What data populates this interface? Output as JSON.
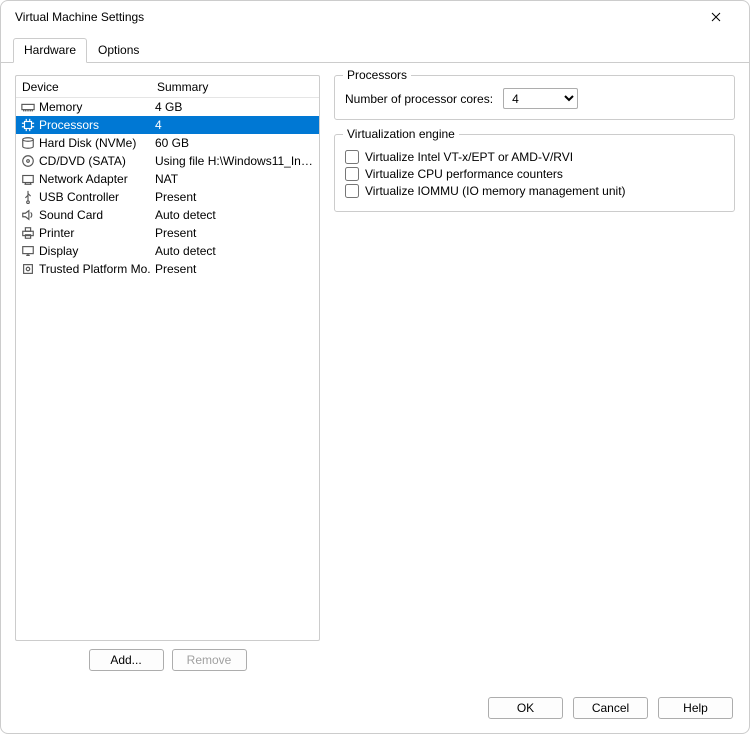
{
  "window": {
    "title": "Virtual Machine Settings"
  },
  "tabs": {
    "hardware": "Hardware",
    "options": "Options"
  },
  "deviceList": {
    "headerDevice": "Device",
    "headerSummary": "Summary",
    "rows": [
      {
        "icon": "memory-icon",
        "name": "Memory",
        "summary": "4 GB"
      },
      {
        "icon": "processors-icon",
        "name": "Processors",
        "summary": "4"
      },
      {
        "icon": "harddisk-icon",
        "name": "Hard Disk (NVMe)",
        "summary": "60 GB"
      },
      {
        "icon": "cddvd-icon",
        "name": "CD/DVD (SATA)",
        "summary": "Using file H:\\Windows11_Ins..."
      },
      {
        "icon": "network-icon",
        "name": "Network Adapter",
        "summary": "NAT"
      },
      {
        "icon": "usb-icon",
        "name": "USB Controller",
        "summary": "Present"
      },
      {
        "icon": "sound-icon",
        "name": "Sound Card",
        "summary": "Auto detect"
      },
      {
        "icon": "printer-icon",
        "name": "Printer",
        "summary": "Present"
      },
      {
        "icon": "display-icon",
        "name": "Display",
        "summary": "Auto detect"
      },
      {
        "icon": "tpm-icon",
        "name": "Trusted Platform Mo...",
        "summary": "Present"
      }
    ],
    "selectedIndex": 1
  },
  "leftButtons": {
    "add": "Add...",
    "remove": "Remove"
  },
  "processors": {
    "legend": "Processors",
    "coresLabel": "Number of processor cores:",
    "coresValue": "4"
  },
  "virtEngine": {
    "legend": "Virtualization engine",
    "vtx": "Virtualize Intel VT-x/EPT or AMD-V/RVI",
    "perf": "Virtualize CPU performance counters",
    "iommu": "Virtualize IOMMU (IO memory management unit)"
  },
  "footer": {
    "ok": "OK",
    "cancel": "Cancel",
    "help": "Help"
  }
}
